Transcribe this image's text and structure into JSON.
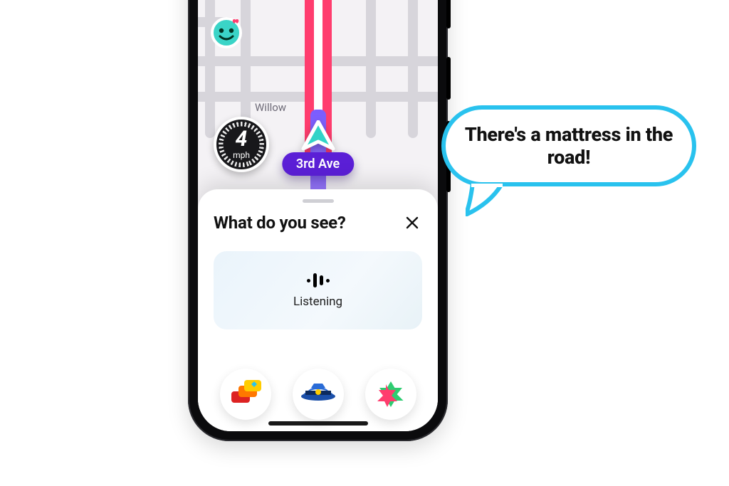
{
  "map": {
    "cross_street_label": "Willow",
    "current_street": "3rd Ave"
  },
  "speed": {
    "value": "4",
    "unit": "mph"
  },
  "sheet": {
    "title": "What do you see?",
    "listening_label": "Listening"
  },
  "bubble": {
    "text": "There's a mattress in the road!"
  },
  "report_chips": [
    "traffic",
    "police",
    "hazard"
  ]
}
